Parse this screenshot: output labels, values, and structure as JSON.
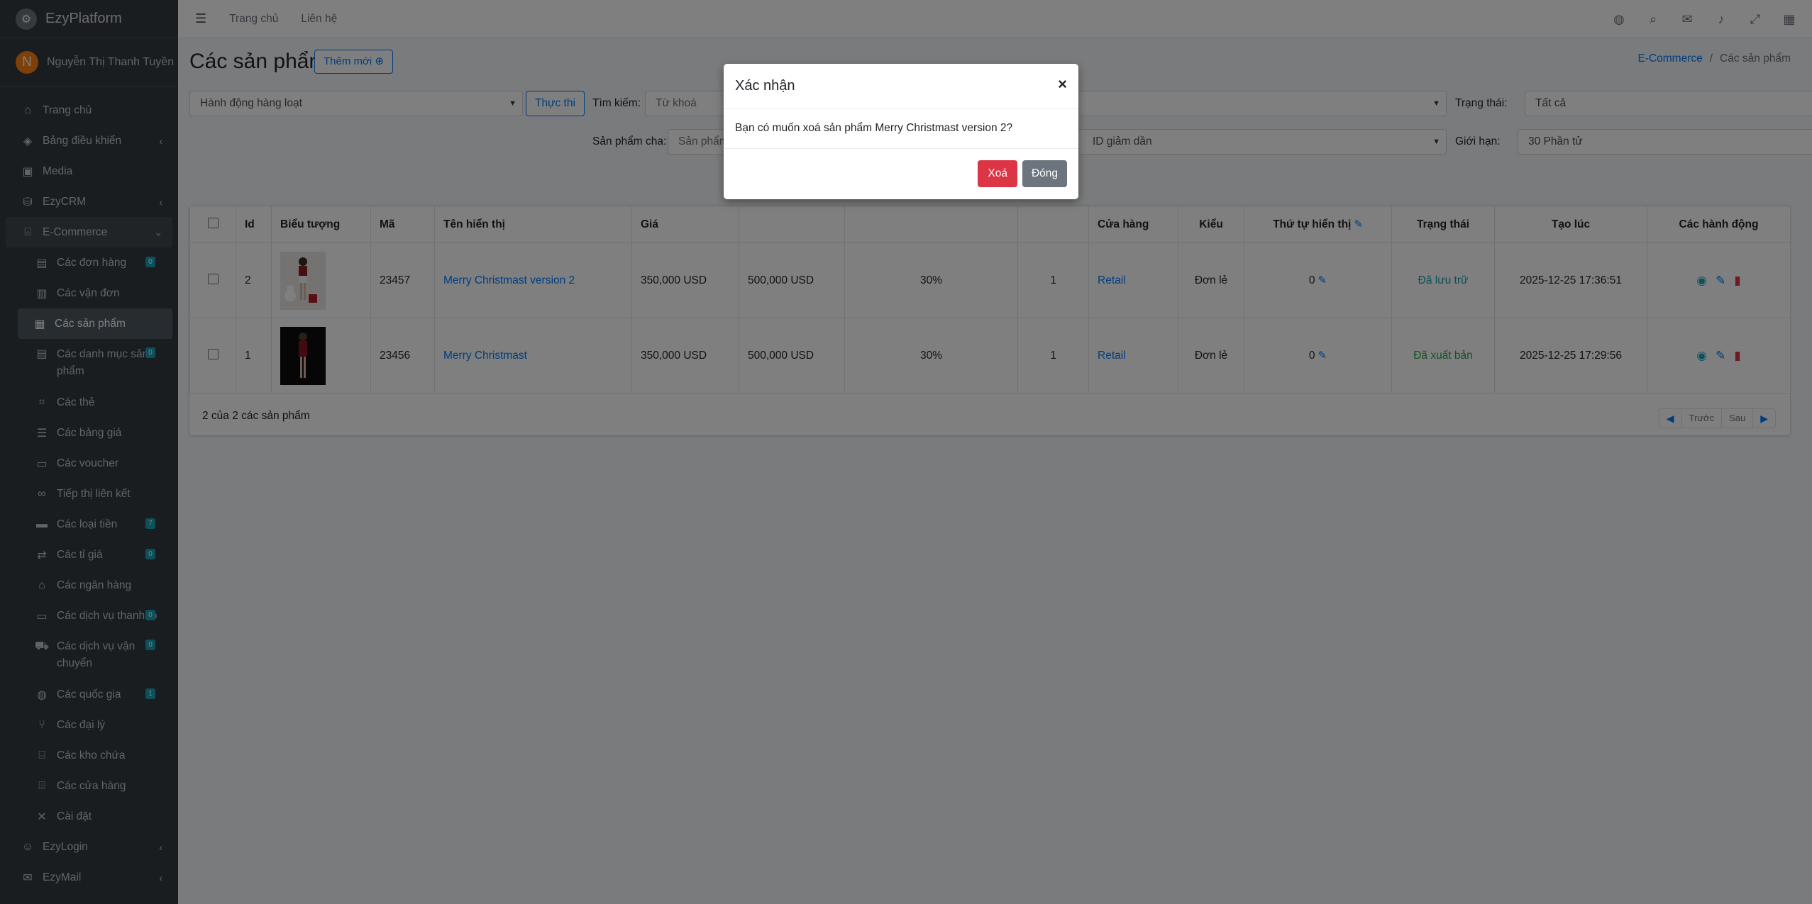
{
  "brand": {
    "name": "EzyPlatform"
  },
  "user": {
    "initial": "N",
    "name": "Nguyễn Thị Thanh Tuyền"
  },
  "sidebar": {
    "items": [
      {
        "label": "Trang chủ",
        "icon": "home-icon"
      },
      {
        "label": "Bảng điều khiển",
        "icon": "handshake-icon"
      },
      {
        "label": "Media",
        "icon": "image-icon"
      },
      {
        "label": "EzyCRM",
        "icon": "crm-icon"
      },
      {
        "label": "E-Commerce",
        "icon": "basket-icon"
      }
    ],
    "sub": [
      {
        "label": "Các đơn hàng",
        "badge": "0"
      },
      {
        "label": "Các vận đơn"
      },
      {
        "label": "Các sản phẩm"
      },
      {
        "label": "Các danh mục sản phẩm",
        "badge": "0"
      },
      {
        "label": "Các thẻ"
      },
      {
        "label": "Các bảng giá"
      },
      {
        "label": "Các voucher"
      },
      {
        "label": "Tiếp thị liên kết"
      },
      {
        "label": "Các loại tiền",
        "badge": "7"
      },
      {
        "label": "Các tỉ giá",
        "badge": "0"
      },
      {
        "label": "Các ngân hàng"
      },
      {
        "label": "Các dịch vụ thanh to",
        "badge": "0"
      },
      {
        "label": "Các dịch vụ vận chuyển",
        "badge": "0"
      },
      {
        "label": "Các quốc gia",
        "badge": "1"
      },
      {
        "label": "Các đại lý"
      },
      {
        "label": "Các kho chứa"
      },
      {
        "label": "Các cửa hàng"
      },
      {
        "label": "Cài đặt"
      }
    ],
    "bottom": [
      {
        "label": "EzyLogin"
      },
      {
        "label": "EzyMail"
      }
    ]
  },
  "topbar": {
    "home": "Trang chủ",
    "contact": "Liên hệ"
  },
  "page": {
    "title": "Các sản phẩm",
    "new_button": "Thêm mới",
    "breadcrumb": {
      "parent": "E-Commerce",
      "current": "Các sản phẩm"
    }
  },
  "filters": {
    "bulk_action": "Hành động hàng loạt",
    "execute": "Thực thi",
    "search_label": "Tìm kiếm:",
    "search_placeholder": "Từ khoá",
    "status_label": "Trạng thái:",
    "status_value": "Tất cả",
    "parent_label": "Sản phẩm cha:",
    "parent_placeholder": "Sản phẩm",
    "sort_value": "ID giảm dần",
    "limit_label": "Giới hạn:",
    "limit_value": "30 Phần tử"
  },
  "table": {
    "headers": {
      "id": "Id",
      "icon": "Biểu tượng",
      "code": "Mã",
      "name": "Tên hiển thị",
      "price": "Giá",
      "store": "Cửa hàng",
      "type": "Kiểu",
      "order": "Thứ tự hiển thị",
      "status": "Trạng thái",
      "created": "Tạo lúc",
      "actions": "Các hành động"
    },
    "rows": [
      {
        "id": "2",
        "code": "23457",
        "name": "Merry Christmast version 2",
        "price": "350,000 USD",
        "orig_price": "500,000 USD",
        "discount": "30%",
        "qty": "1",
        "store": "Retail",
        "type": "Đơn lẻ",
        "order": "0",
        "status": "Đã lưu trữ",
        "created": "2025-12-25 17:36:51"
      },
      {
        "id": "1",
        "code": "23456",
        "name": "Merry Christmast",
        "price": "350,000 USD",
        "orig_price": "500,000 USD",
        "discount": "30%",
        "qty": "1",
        "store": "Retail",
        "type": "Đơn lẻ",
        "order": "0",
        "status": "Đã xuất bản",
        "created": "2025-12-25 17:29:56"
      }
    ],
    "footer": "2 của 2 các sản phẩm",
    "pager": {
      "prev": "Trước",
      "next": "Sau"
    }
  },
  "modal": {
    "title": "Xác nhận",
    "close_symbol": "×",
    "message": "Bạn có muốn xoá sản phẩm Merry Christmast version 2?",
    "delete": "Xoá",
    "close": "Đóng"
  },
  "colors": {
    "primary": "#007bff",
    "danger": "#dc3545",
    "info": "#17a2b8",
    "success": "#28a745",
    "sidebar": "#343a40"
  }
}
